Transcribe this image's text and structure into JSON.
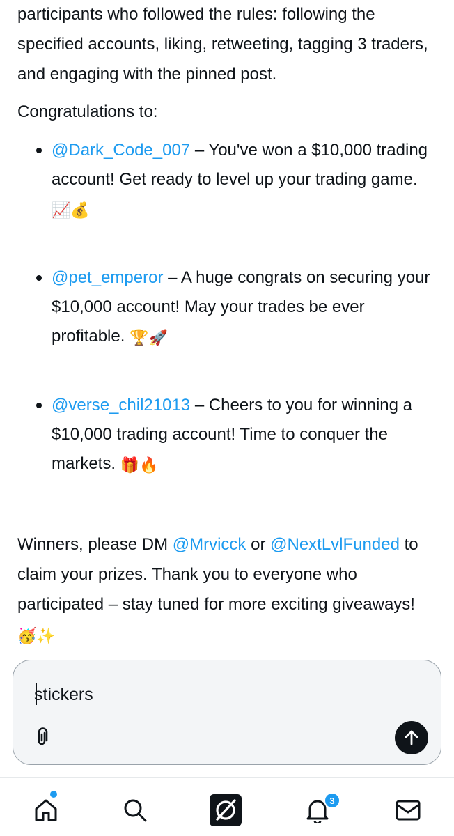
{
  "post": {
    "intro": "participants who followed the rules: following the specified accounts, liking, retweeting, tagging 3 traders, and engaging with the pinned post.",
    "congrats_title": "Congratulations to:",
    "winners": [
      {
        "handle": "@Dark_Code_007",
        "message": " – You've won a $10,000 trading account! Get ready to level up your trading game.",
        "emojis": "📈💰"
      },
      {
        "handle": "@pet_emperor",
        "message": " – A huge congrats on securing your $10,000 account! May your trades be ever profitable. ",
        "emojis": "🏆🚀"
      },
      {
        "handle": "@verse_chil21013",
        "message": " – Cheers to you for winning a $10,000 trading account! Time to conquer the markets. ",
        "emojis": "🎁🔥"
      }
    ],
    "closing": {
      "part1": "Winners, please DM ",
      "link1": "@Mrvicck",
      "part2": " or ",
      "link2": "@NextLvlFunded",
      "part3": " to claim your prizes. Thank you to everyone who participated – stay tuned for more exciting giveaways!",
      "emojis": "🥳✨"
    }
  },
  "composer": {
    "value": "stickers"
  },
  "nav": {
    "notification_count": "3"
  },
  "colors": {
    "accent": "#1d9bf0",
    "text": "#0f1419"
  }
}
